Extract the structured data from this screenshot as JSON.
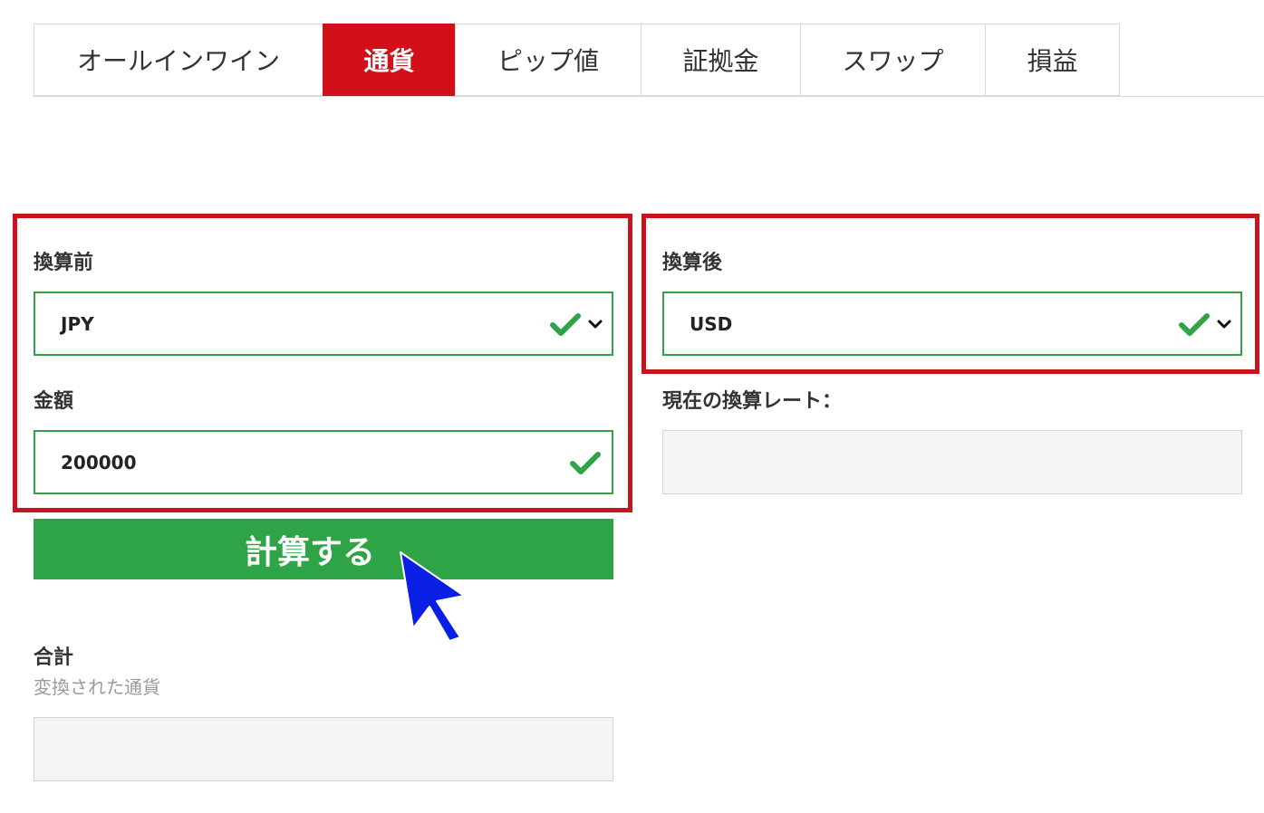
{
  "tabs": [
    {
      "label": "オールインワイン",
      "active": false
    },
    {
      "label": "通貨",
      "active": true
    },
    {
      "label": "ピップ値",
      "active": false
    },
    {
      "label": "証拠金",
      "active": false
    },
    {
      "label": "スワップ",
      "active": false
    },
    {
      "label": "損益",
      "active": false
    }
  ],
  "from": {
    "label": "換算前",
    "currency": "JPY"
  },
  "amount": {
    "label": "金額",
    "value": "200000"
  },
  "to": {
    "label": "換算後",
    "currency": "USD"
  },
  "rate": {
    "label": "現在の換算レート：",
    "value": ""
  },
  "calculate_button": {
    "label": "計算する"
  },
  "total": {
    "label": "合計",
    "sublabel": "変換された通貨",
    "value": ""
  },
  "icons": {
    "valid": "check-icon",
    "dropdown": "chevron-down-icon",
    "pointer": "mouse-cursor-icon"
  },
  "colors": {
    "accent_red": "#d2101a",
    "highlight_red": "#c8141d",
    "success_green": "#2ea446",
    "cursor_blue": "#0a1fe6"
  }
}
